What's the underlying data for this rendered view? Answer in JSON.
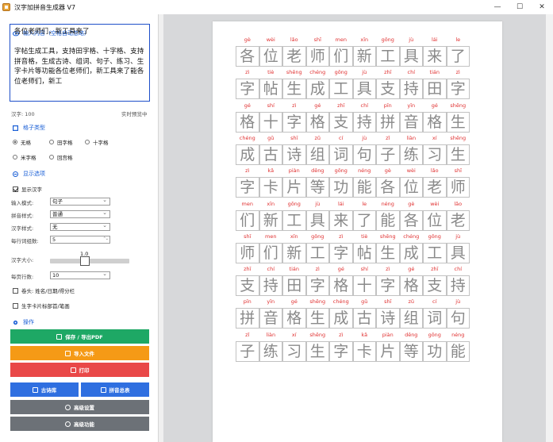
{
  "window": {
    "title": "汉字加拼音生成器 V7",
    "min": "—",
    "max": "☐",
    "close": "✕"
  },
  "input_section": {
    "title": "输入内容（空格自动忽略）",
    "text": "各位老师们，新工具来了\n\n字帖生成工具，支持田字格、十字格、支持拼音格，生成古诗、组词、句子、练习、生字卡片等功能各位老师们，新工具来了能各位老师们，新工",
    "char_count": "汉字: 100",
    "preview_hint": "实时预览中"
  },
  "grid_type": {
    "title": "格子类型",
    "options": [
      "无格",
      "田字格",
      "十字格",
      "米字格",
      "回宫格"
    ],
    "selected": "无格"
  },
  "display": {
    "title": "显示选项",
    "show_hanzi": "显示汉字",
    "fields": [
      {
        "label": "输入模式:",
        "value": "句子"
      },
      {
        "label": "拼音样式:",
        "value": "普通"
      },
      {
        "label": "汉字样式:",
        "value": "无"
      },
      {
        "label": "每行词组数:",
        "value": "5"
      }
    ],
    "size_label": "汉字大小:",
    "size_value": "1.0",
    "rows_label": "每页行数:",
    "rows_value": "10",
    "header_option": "卷头: 姓名/日期/得分栏",
    "card_option": "生字卡片标部首/笔画"
  },
  "actions": {
    "title": "操作",
    "save": "保存 / 导出PDF",
    "import": "导入文件",
    "print": "打印",
    "poems": "古诗库",
    "pinyin_table": "拼音总表",
    "advanced_settings": "高级设置",
    "advanced_features": "高级功能"
  },
  "colors": {
    "primary": "#1a5fd6",
    "save": "#1ea865",
    "import": "#f59a16",
    "print": "#e94848",
    "blue_btn": "#2f6fe0",
    "gray_btn": "#6c7177",
    "pinyin": "#e03030"
  },
  "worksheet": [
    {
      "py": [
        "gè",
        "wèi",
        "lǎo",
        "shī",
        "men",
        "xīn",
        "gōng",
        "jù",
        "lái",
        "le"
      ],
      "hz": [
        "各",
        "位",
        "老",
        "师",
        "们",
        "新",
        "工",
        "具",
        "来",
        "了"
      ]
    },
    {
      "py": [
        "zì",
        "tiè",
        "shēng",
        "chéng",
        "gōng",
        "jù",
        "zhī",
        "chí",
        "tián",
        "zì"
      ],
      "hz": [
        "字",
        "帖",
        "生",
        "成",
        "工",
        "具",
        "支",
        "持",
        "田",
        "字"
      ]
    },
    {
      "py": [
        "gé",
        "shí",
        "zì",
        "gé",
        "zhī",
        "chí",
        "pīn",
        "yīn",
        "gé",
        "shēng"
      ],
      "hz": [
        "格",
        "十",
        "字",
        "格",
        "支",
        "持",
        "拼",
        "音",
        "格",
        "生"
      ]
    },
    {
      "py": [
        "chéng",
        "gǔ",
        "shī",
        "zǔ",
        "cí",
        "jù",
        "zǐ",
        "liàn",
        "xí",
        "shēng"
      ],
      "hz": [
        "成",
        "古",
        "诗",
        "组",
        "词",
        "句",
        "子",
        "练",
        "习",
        "生"
      ]
    },
    {
      "py": [
        "zì",
        "kǎ",
        "piàn",
        "děng",
        "gōng",
        "néng",
        "gè",
        "wèi",
        "lǎo",
        "shī"
      ],
      "hz": [
        "字",
        "卡",
        "片",
        "等",
        "功",
        "能",
        "各",
        "位",
        "老",
        "师"
      ]
    },
    {
      "py": [
        "men",
        "xīn",
        "gōng",
        "jù",
        "lái",
        "le",
        "néng",
        "gè",
        "wèi",
        "lǎo"
      ],
      "hz": [
        "们",
        "新",
        "工",
        "具",
        "来",
        "了",
        "能",
        "各",
        "位",
        "老"
      ]
    },
    {
      "py": [
        "shī",
        "men",
        "xīn",
        "gōng",
        "zì",
        "tiè",
        "shēng",
        "chéng",
        "gōng",
        "jù"
      ],
      "hz": [
        "师",
        "们",
        "新",
        "工",
        "字",
        "帖",
        "生",
        "成",
        "工",
        "具"
      ]
    },
    {
      "py": [
        "zhī",
        "chí",
        "tián",
        "zì",
        "gé",
        "shí",
        "zì",
        "gé",
        "zhī",
        "chí"
      ],
      "hz": [
        "支",
        "持",
        "田",
        "字",
        "格",
        "十",
        "字",
        "格",
        "支",
        "持"
      ]
    },
    {
      "py": [
        "pīn",
        "yīn",
        "gé",
        "shēng",
        "chéng",
        "gǔ",
        "shī",
        "zǔ",
        "cí",
        "jù"
      ],
      "hz": [
        "拼",
        "音",
        "格",
        "生",
        "成",
        "古",
        "诗",
        "组",
        "词",
        "句"
      ]
    },
    {
      "py": [
        "zǐ",
        "liàn",
        "xí",
        "shēng",
        "zì",
        "kǎ",
        "piàn",
        "děng",
        "gōng",
        "néng"
      ],
      "hz": [
        "子",
        "练",
        "习",
        "生",
        "字",
        "卡",
        "片",
        "等",
        "功",
        "能"
      ]
    }
  ]
}
